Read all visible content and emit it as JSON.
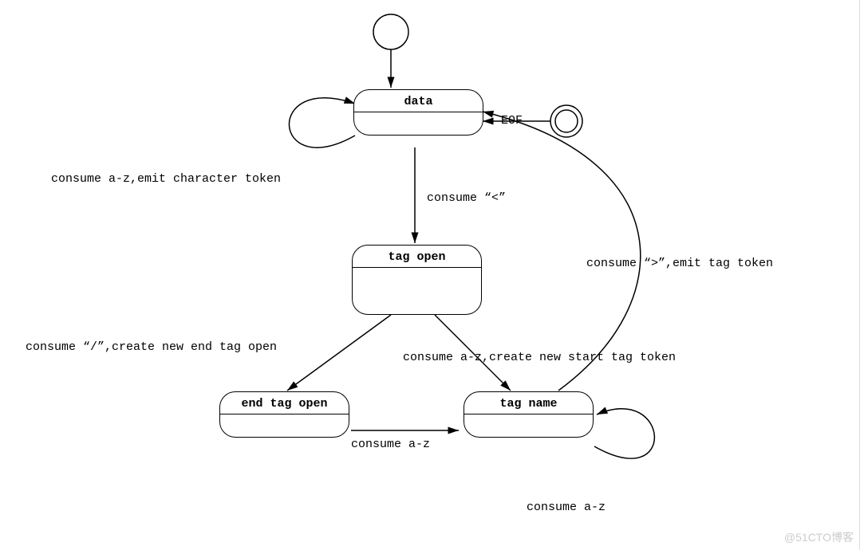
{
  "states": {
    "data": "data",
    "tag_open": "tag open",
    "end_tag_open": "end tag open",
    "tag_name": "tag name"
  },
  "edges": {
    "consume_char": "consume a-z,emit character token",
    "eof": "EOF",
    "consume_lt": "consume “<”",
    "consume_gt": "consume “>”,emit tag token",
    "consume_slash": "consume “/”,create new end tag open",
    "consume_az_start": "consume a-z,create new start tag token",
    "consume_az": "consume a-z",
    "consume_az_loop": "consume a-z"
  },
  "watermark": "@51CTO博客"
}
